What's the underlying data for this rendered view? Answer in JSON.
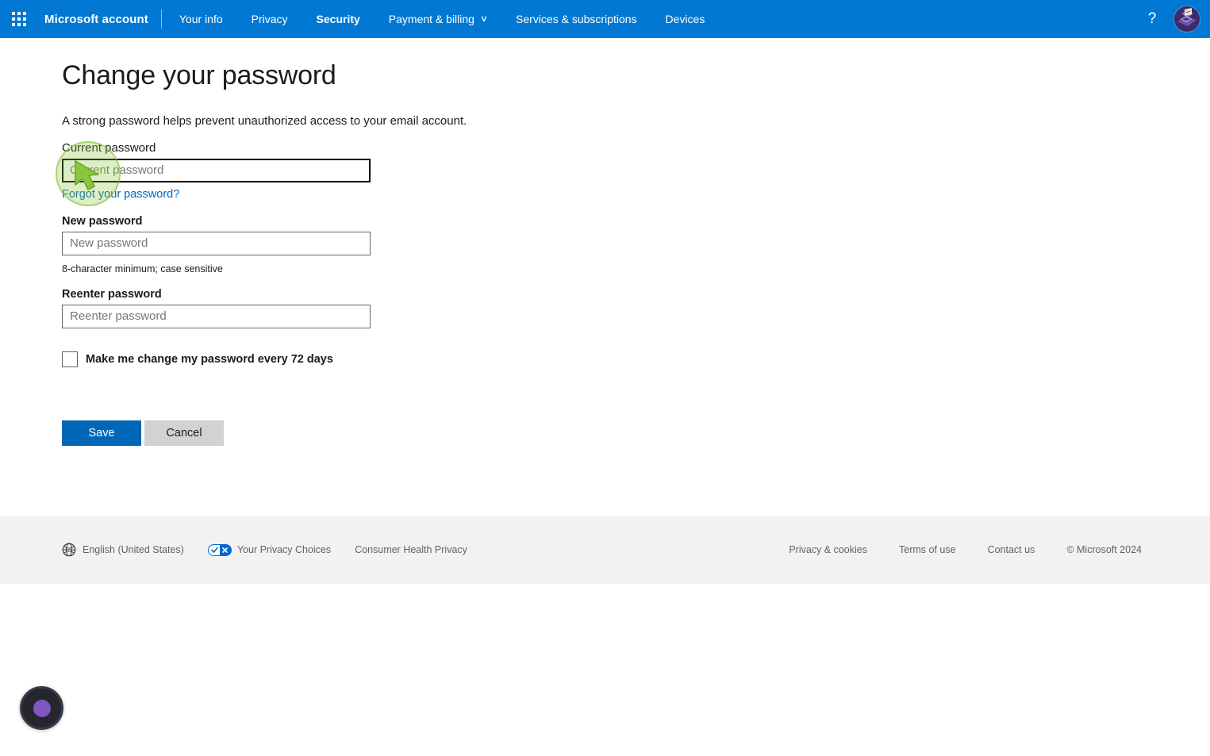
{
  "header": {
    "waffle_label": "App launcher",
    "brand": "Microsoft account",
    "nav": [
      {
        "label": "Your info",
        "selected": false,
        "has_chevron": false
      },
      {
        "label": "Privacy",
        "selected": false,
        "has_chevron": false
      },
      {
        "label": "Security",
        "selected": true,
        "has_chevron": false
      },
      {
        "label": "Payment & billing",
        "selected": false,
        "has_chevron": true
      },
      {
        "label": "Services & subscriptions",
        "selected": false,
        "has_chevron": false
      },
      {
        "label": "Devices",
        "selected": false,
        "has_chevron": false
      }
    ],
    "chevron_glyph": "∨",
    "help_glyph": "?",
    "avatar_label": "Account avatar",
    "accent_color": "#0078d4"
  },
  "main": {
    "title": "Change your password",
    "subtitle": "A strong password helps prevent unauthorized access to your email account.",
    "fields": {
      "current": {
        "label": "Current password",
        "placeholder": "Current password",
        "value": "",
        "focused": true
      },
      "new": {
        "label": "New password",
        "placeholder": "New password",
        "value": "",
        "hint": "8-character minimum; case sensitive"
      },
      "reenter": {
        "label": "Reenter password",
        "placeholder": "Reenter password",
        "value": ""
      }
    },
    "forgot_link": "Forgot your password?",
    "checkbox": {
      "label": "Make me change my password every 72 days",
      "checked": false
    },
    "buttons": {
      "save": "Save",
      "cancel": "Cancel"
    },
    "link_color": "#0067b8",
    "primary_button_color": "#0067b8"
  },
  "footer": {
    "language": "English (United States)",
    "privacy_choices": "Your Privacy Choices",
    "consumer_health": "Consumer Health Privacy",
    "privacy_cookies": "Privacy & cookies",
    "terms": "Terms of use",
    "contact": "Contact us",
    "copyright": "© Microsoft 2024"
  },
  "overlays": {
    "click_highlight": "green click halo over current password field",
    "cursor": "green arrow cursor",
    "recording_indicator": "screen recording indicator"
  }
}
